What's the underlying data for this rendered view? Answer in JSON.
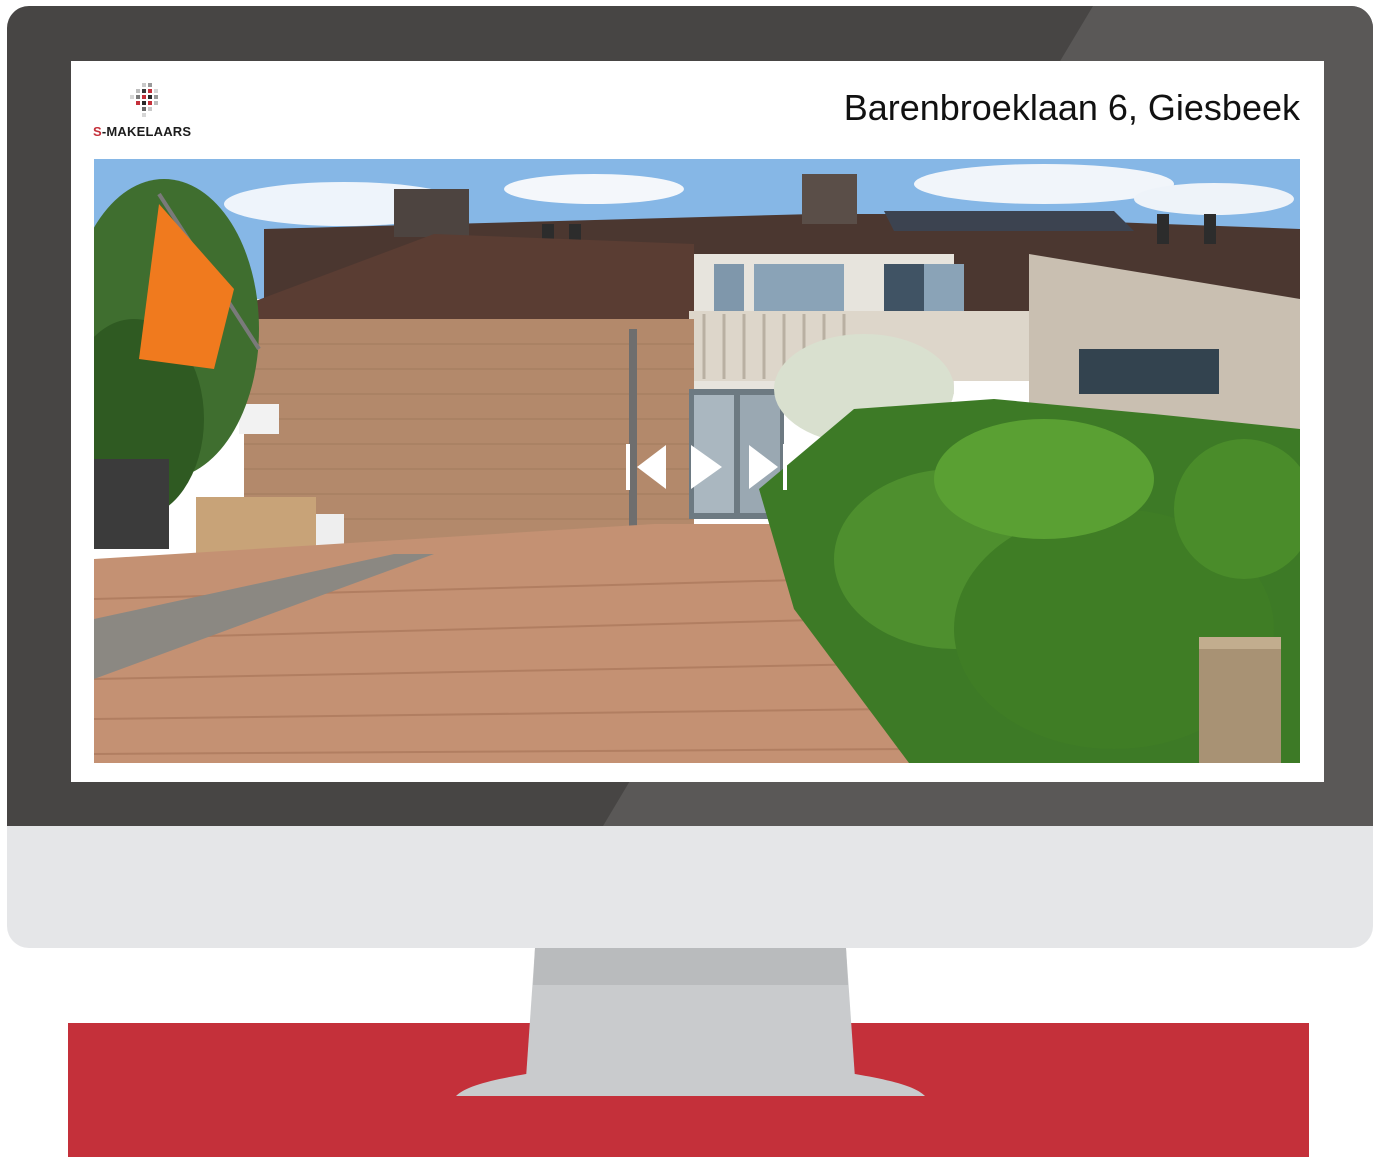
{
  "listing": {
    "address": "Barenbroeklaan 6, Giesbeek"
  },
  "brand": {
    "name_prefix": "S",
    "name_suffix": "-MAKELAARS",
    "accent_color": "#c4303a",
    "logo_icon": "pixel-grid-logo-icon"
  },
  "player": {
    "icons": [
      "skip-back-icon",
      "play-icon",
      "skip-forward-icon"
    ]
  },
  "photo": {
    "description_icon": "house-photo"
  },
  "colors": {
    "bezel": "#474544",
    "chin": "#e5e6e8",
    "floor": "#c4303a",
    "stand": "#c9cbcd"
  }
}
